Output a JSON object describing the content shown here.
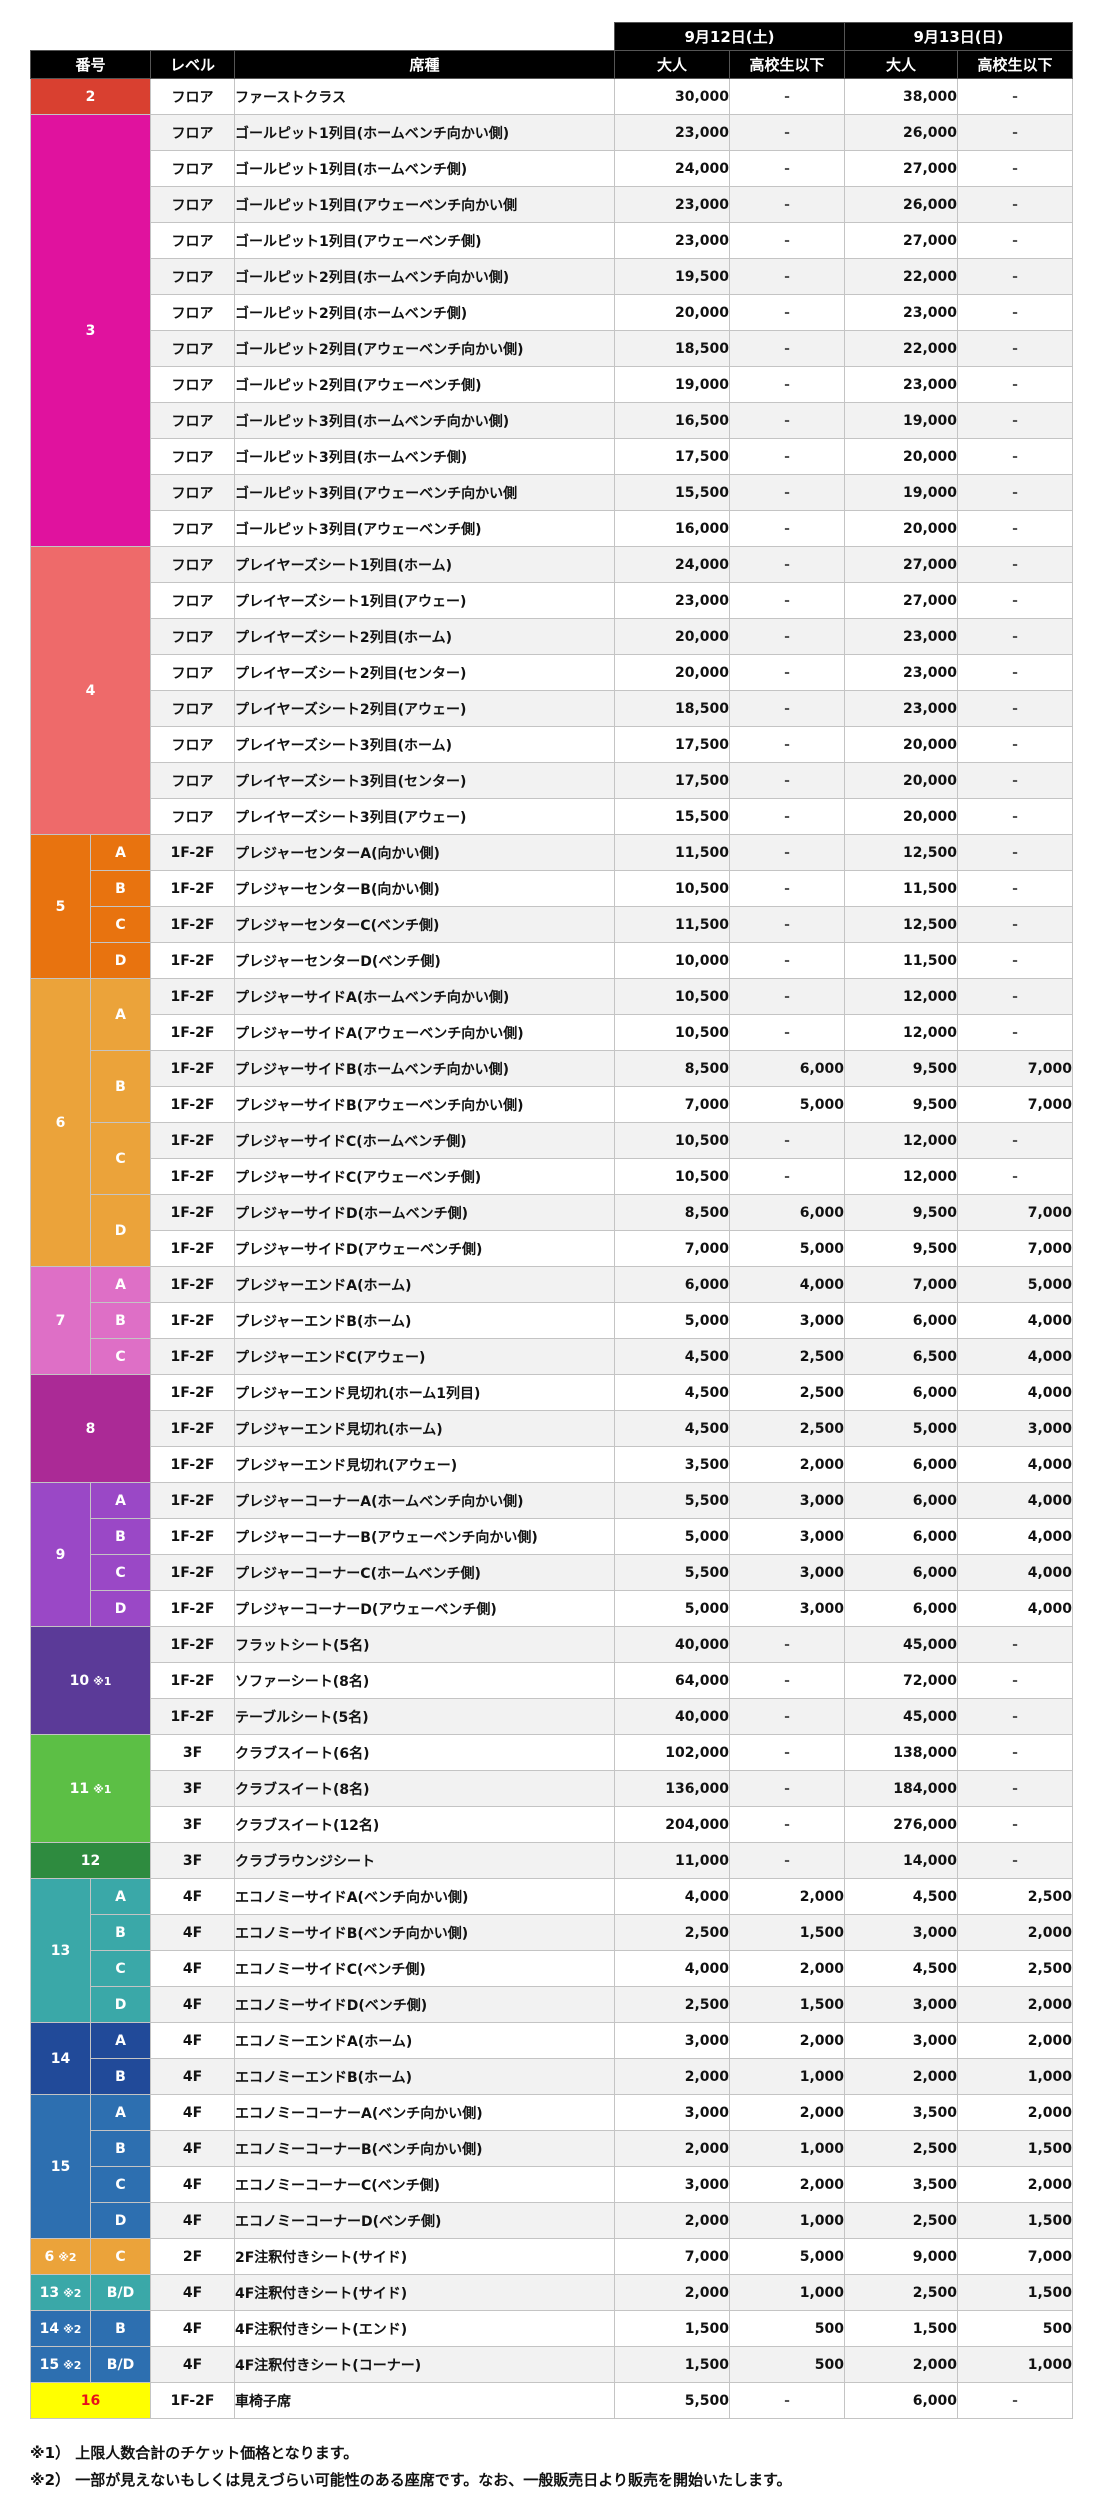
{
  "headers": {
    "date1": "9月12日(土)",
    "date2": "9月13日(日)",
    "num": "番号",
    "level": "レベル",
    "seat": "席種",
    "adult": "大人",
    "student": "高校生以下"
  },
  "colors": {
    "2": "#d94030",
    "3": "#e0129e",
    "4": "#ee6a6a",
    "5": "#e8730f",
    "6": "#eba33a",
    "7": "#de6fc6",
    "8": "#ab2a96",
    "9": "#9a48c6",
    "10": "#5b3a98",
    "11": "#5cbf45",
    "12": "#2e8b3f",
    "13": "#3aa8a8",
    "14": "#214a99",
    "15": "#2d6fb0",
    "16": "#ffff00",
    "6x": "#eba33a",
    "13x": "#3aa8a8",
    "14x": "#2d6fb0",
    "15x": "#2d6fb0"
  },
  "groups": [
    {
      "num": "2",
      "color_key": "2",
      "rows": [
        {
          "level": "フロア",
          "seat": "ファーストクラス",
          "p": [
            "30,000",
            "-",
            "38,000",
            "-"
          ]
        }
      ]
    },
    {
      "num": "3",
      "color_key": "3",
      "rows": [
        {
          "level": "フロア",
          "seat": "ゴールピット1列目(ホームベンチ向かい側)",
          "p": [
            "23,000",
            "-",
            "26,000",
            "-"
          ]
        },
        {
          "level": "フロア",
          "seat": "ゴールピット1列目(ホームベンチ側)",
          "p": [
            "24,000",
            "-",
            "27,000",
            "-"
          ]
        },
        {
          "level": "フロア",
          "seat": "ゴールピット1列目(アウェーベンチ向かい側",
          "p": [
            "23,000",
            "-",
            "26,000",
            "-"
          ]
        },
        {
          "level": "フロア",
          "seat": "ゴールピット1列目(アウェーベンチ側)",
          "p": [
            "23,000",
            "-",
            "27,000",
            "-"
          ]
        },
        {
          "level": "フロア",
          "seat": "ゴールピット2列目(ホームベンチ向かい側)",
          "p": [
            "19,500",
            "-",
            "22,000",
            "-"
          ]
        },
        {
          "level": "フロア",
          "seat": "ゴールピット2列目(ホームベンチ側)",
          "p": [
            "20,000",
            "-",
            "23,000",
            "-"
          ]
        },
        {
          "level": "フロア",
          "seat": "ゴールピット2列目(アウェーベンチ向かい側)",
          "p": [
            "18,500",
            "-",
            "22,000",
            "-"
          ]
        },
        {
          "level": "フロア",
          "seat": "ゴールピット2列目(アウェーベンチ側)",
          "p": [
            "19,000",
            "-",
            "23,000",
            "-"
          ]
        },
        {
          "level": "フロア",
          "seat": "ゴールピット3列目(ホームベンチ向かい側)",
          "p": [
            "16,500",
            "-",
            "19,000",
            "-"
          ]
        },
        {
          "level": "フロア",
          "seat": "ゴールピット3列目(ホームベンチ側)",
          "p": [
            "17,500",
            "-",
            "20,000",
            "-"
          ]
        },
        {
          "level": "フロア",
          "seat": "ゴールピット3列目(アウェーベンチ向かい側",
          "p": [
            "15,500",
            "-",
            "19,000",
            "-"
          ]
        },
        {
          "level": "フロア",
          "seat": "ゴールピット3列目(アウェーベンチ側)",
          "p": [
            "16,000",
            "-",
            "20,000",
            "-"
          ]
        }
      ]
    },
    {
      "num": "4",
      "color_key": "4",
      "rows": [
        {
          "level": "フロア",
          "seat": "プレイヤーズシート1列目(ホーム)",
          "p": [
            "24,000",
            "-",
            "27,000",
            "-"
          ]
        },
        {
          "level": "フロア",
          "seat": "プレイヤーズシート1列目(アウェー)",
          "p": [
            "23,000",
            "-",
            "27,000",
            "-"
          ]
        },
        {
          "level": "フロア",
          "seat": "プレイヤーズシート2列目(ホーム)",
          "p": [
            "20,000",
            "-",
            "23,000",
            "-"
          ]
        },
        {
          "level": "フロア",
          "seat": "プレイヤーズシート2列目(センター)",
          "p": [
            "20,000",
            "-",
            "23,000",
            "-"
          ]
        },
        {
          "level": "フロア",
          "seat": "プレイヤーズシート2列目(アウェー)",
          "p": [
            "18,500",
            "-",
            "23,000",
            "-"
          ]
        },
        {
          "level": "フロア",
          "seat": "プレイヤーズシート3列目(ホーム)",
          "p": [
            "17,500",
            "-",
            "20,000",
            "-"
          ]
        },
        {
          "level": "フロア",
          "seat": "プレイヤーズシート3列目(センター)",
          "p": [
            "17,500",
            "-",
            "20,000",
            "-"
          ]
        },
        {
          "level": "フロア",
          "seat": "プレイヤーズシート3列目(アウェー)",
          "p": [
            "15,500",
            "-",
            "20,000",
            "-"
          ]
        }
      ]
    },
    {
      "num": "5",
      "color_key": "5",
      "rows": [
        {
          "sub": "A",
          "level": "1F-2F",
          "seat": "プレジャーセンターA(向かい側)",
          "p": [
            "11,500",
            "-",
            "12,500",
            "-"
          ]
        },
        {
          "sub": "B",
          "level": "1F-2F",
          "seat": "プレジャーセンターB(向かい側)",
          "p": [
            "10,500",
            "-",
            "11,500",
            "-"
          ]
        },
        {
          "sub": "C",
          "level": "1F-2F",
          "seat": "プレジャーセンターC(ベンチ側)",
          "p": [
            "11,500",
            "-",
            "12,500",
            "-"
          ]
        },
        {
          "sub": "D",
          "level": "1F-2F",
          "seat": "プレジャーセンターD(ベンチ側)",
          "p": [
            "10,000",
            "-",
            "11,500",
            "-"
          ]
        }
      ]
    },
    {
      "num": "6",
      "color_key": "6",
      "rows": [
        {
          "sub": "A",
          "level": "1F-2F",
          "seat": "プレジャーサイドA(ホームベンチ向かい側)",
          "p": [
            "10,500",
            "-",
            "12,000",
            "-"
          ]
        },
        {
          "sub": "A",
          "level": "1F-2F",
          "seat": "プレジャーサイドA(アウェーベンチ向かい側)",
          "p": [
            "10,500",
            "-",
            "12,000",
            "-"
          ]
        },
        {
          "sub": "B",
          "level": "1F-2F",
          "seat": "プレジャーサイドB(ホームベンチ向かい側)",
          "p": [
            "8,500",
            "6,000",
            "9,500",
            "7,000"
          ]
        },
        {
          "sub": "B",
          "level": "1F-2F",
          "seat": "プレジャーサイドB(アウェーベンチ向かい側)",
          "p": [
            "7,000",
            "5,000",
            "9,500",
            "7,000"
          ]
        },
        {
          "sub": "C",
          "level": "1F-2F",
          "seat": "プレジャーサイドC(ホームベンチ側)",
          "p": [
            "10,500",
            "-",
            "12,000",
            "-"
          ]
        },
        {
          "sub": "C",
          "level": "1F-2F",
          "seat": "プレジャーサイドC(アウェーベンチ側)",
          "p": [
            "10,500",
            "-",
            "12,000",
            "-"
          ]
        },
        {
          "sub": "D",
          "level": "1F-2F",
          "seat": "プレジャーサイドD(ホームベンチ側)",
          "p": [
            "8,500",
            "6,000",
            "9,500",
            "7,000"
          ]
        },
        {
          "sub": "D",
          "level": "1F-2F",
          "seat": "プレジャーサイドD(アウェーベンチ側)",
          "p": [
            "7,000",
            "5,000",
            "9,500",
            "7,000"
          ]
        }
      ]
    },
    {
      "num": "7",
      "color_key": "7",
      "rows": [
        {
          "sub": "A",
          "level": "1F-2F",
          "seat": "プレジャーエンドA(ホーム)",
          "p": [
            "6,000",
            "4,000",
            "7,000",
            "5,000"
          ]
        },
        {
          "sub": "B",
          "level": "1F-2F",
          "seat": "プレジャーエンドB(ホーム)",
          "p": [
            "5,000",
            "3,000",
            "6,000",
            "4,000"
          ]
        },
        {
          "sub": "C",
          "level": "1F-2F",
          "seat": "プレジャーエンドC(アウェー)",
          "p": [
            "4,500",
            "2,500",
            "6,500",
            "4,000"
          ]
        }
      ]
    },
    {
      "num": "8",
      "color_key": "8",
      "rows": [
        {
          "level": "1F-2F",
          "seat": "プレジャーエンド見切れ(ホーム1列目)",
          "p": [
            "4,500",
            "2,500",
            "6,000",
            "4,000"
          ]
        },
        {
          "level": "1F-2F",
          "seat": "プレジャーエンド見切れ(ホーム)",
          "p": [
            "4,500",
            "2,500",
            "5,000",
            "3,000"
          ]
        },
        {
          "level": "1F-2F",
          "seat": "プレジャーエンド見切れ(アウェー)",
          "p": [
            "3,500",
            "2,000",
            "6,000",
            "4,000"
          ]
        }
      ]
    },
    {
      "num": "9",
      "color_key": "9",
      "rows": [
        {
          "sub": "A",
          "level": "1F-2F",
          "seat": "プレジャーコーナーA(ホームベンチ向かい側)",
          "p": [
            "5,500",
            "3,000",
            "6,000",
            "4,000"
          ]
        },
        {
          "sub": "B",
          "level": "1F-2F",
          "seat": "プレジャーコーナーB(アウェーベンチ向かい側)",
          "p": [
            "5,000",
            "3,000",
            "6,000",
            "4,000"
          ]
        },
        {
          "sub": "C",
          "level": "1F-2F",
          "seat": "プレジャーコーナーC(ホームベンチ側)",
          "p": [
            "5,500",
            "3,000",
            "6,000",
            "4,000"
          ]
        },
        {
          "sub": "D",
          "level": "1F-2F",
          "seat": "プレジャーコーナーD(アウェーベンチ側)",
          "p": [
            "5,000",
            "3,000",
            "6,000",
            "4,000"
          ]
        }
      ]
    },
    {
      "num": "10",
      "note": "※1",
      "color_key": "10",
      "rows": [
        {
          "level": "1F-2F",
          "seat": "フラットシート(5名)",
          "p": [
            "40,000",
            "-",
            "45,000",
            "-"
          ]
        },
        {
          "level": "1F-2F",
          "seat": "ソファーシート(8名)",
          "p": [
            "64,000",
            "-",
            "72,000",
            "-"
          ]
        },
        {
          "level": "1F-2F",
          "seat": "テーブルシート(5名)",
          "p": [
            "40,000",
            "-",
            "45,000",
            "-"
          ]
        }
      ]
    },
    {
      "num": "11",
      "note": "※1",
      "color_key": "11",
      "rows": [
        {
          "level": "3F",
          "seat": "クラブスイート(6名)",
          "p": [
            "102,000",
            "-",
            "138,000",
            "-"
          ]
        },
        {
          "level": "3F",
          "seat": "クラブスイート(8名)",
          "p": [
            "136,000",
            "-",
            "184,000",
            "-"
          ]
        },
        {
          "level": "3F",
          "seat": "クラブスイート(12名)",
          "p": [
            "204,000",
            "-",
            "276,000",
            "-"
          ]
        }
      ]
    },
    {
      "num": "12",
      "color_key": "12",
      "rows": [
        {
          "level": "3F",
          "seat": "クラブラウンジシート",
          "p": [
            "11,000",
            "-",
            "14,000",
            "-"
          ]
        }
      ]
    },
    {
      "num": "13",
      "color_key": "13",
      "rows": [
        {
          "sub": "A",
          "level": "4F",
          "seat": "エコノミーサイドA(ベンチ向かい側)",
          "p": [
            "4,000",
            "2,000",
            "4,500",
            "2,500"
          ]
        },
        {
          "sub": "B",
          "level": "4F",
          "seat": "エコノミーサイドB(ベンチ向かい側)",
          "p": [
            "2,500",
            "1,500",
            "3,000",
            "2,000"
          ]
        },
        {
          "sub": "C",
          "level": "4F",
          "seat": "エコノミーサイドC(ベンチ側)",
          "p": [
            "4,000",
            "2,000",
            "4,500",
            "2,500"
          ]
        },
        {
          "sub": "D",
          "level": "4F",
          "seat": "エコノミーサイドD(ベンチ側)",
          "p": [
            "2,500",
            "1,500",
            "3,000",
            "2,000"
          ]
        }
      ]
    },
    {
      "num": "14",
      "color_key": "14",
      "rows": [
        {
          "sub": "A",
          "level": "4F",
          "seat": "エコノミーエンドA(ホーム)",
          "p": [
            "3,000",
            "2,000",
            "3,000",
            "2,000"
          ]
        },
        {
          "sub": "B",
          "level": "4F",
          "seat": "エコノミーエンドB(ホーム)",
          "p": [
            "2,000",
            "1,000",
            "2,000",
            "1,000"
          ]
        }
      ]
    },
    {
      "num": "15",
      "color_key": "15",
      "rows": [
        {
          "sub": "A",
          "level": "4F",
          "seat": "エコノミーコーナーA(ベンチ向かい側)",
          "p": [
            "3,000",
            "2,000",
            "3,500",
            "2,000"
          ]
        },
        {
          "sub": "B",
          "level": "4F",
          "seat": "エコノミーコーナーB(ベンチ向かい側)",
          "p": [
            "2,000",
            "1,000",
            "2,500",
            "1,500"
          ]
        },
        {
          "sub": "C",
          "level": "4F",
          "seat": "エコノミーコーナーC(ベンチ側)",
          "p": [
            "3,000",
            "2,000",
            "3,500",
            "2,000"
          ]
        },
        {
          "sub": "D",
          "level": "4F",
          "seat": "エコノミーコーナーD(ベンチ側)",
          "p": [
            "2,000",
            "1,000",
            "2,500",
            "1,500"
          ]
        }
      ]
    },
    {
      "num": "6",
      "note": "※2",
      "color_key": "6x",
      "rows": [
        {
          "sub": "C",
          "level": "2F",
          "seat": "2F注釈付きシート(サイド)",
          "p": [
            "7,000",
            "5,000",
            "9,000",
            "7,000"
          ]
        }
      ]
    },
    {
      "num": "13",
      "note": "※2",
      "color_key": "13x",
      "rows": [
        {
          "sub": "B/D",
          "level": "4F",
          "seat": "4F注釈付きシート(サイド)",
          "p": [
            "2,000",
            "1,000",
            "2,500",
            "1,500"
          ]
        }
      ]
    },
    {
      "num": "14",
      "note": "※2",
      "color_key": "14x",
      "rows": [
        {
          "sub": "B",
          "level": "4F",
          "seat": "4F注釈付きシート(エンド)",
          "p": [
            "1,500",
            "500",
            "1,500",
            "500"
          ]
        }
      ]
    },
    {
      "num": "15",
      "note": "※2",
      "color_key": "15x",
      "rows": [
        {
          "sub": "B/D",
          "level": "4F",
          "seat": "4F注釈付きシート(コーナー)",
          "p": [
            "1,500",
            "500",
            "2,000",
            "1,000"
          ]
        }
      ]
    },
    {
      "num": "16",
      "color_key": "16",
      "text_color": "#e8101a",
      "rows": [
        {
          "level": "1F-2F",
          "seat": "車椅子席",
          "p": [
            "5,500",
            "-",
            "6,000",
            "-"
          ]
        }
      ]
    }
  ],
  "notes": [
    "※1） 上限人数合計のチケット価格となります。",
    "※2） 一部が見えないもしくは見えづらい可能性のある座席です。なお、一般販売日より販売を開始いたします。"
  ]
}
